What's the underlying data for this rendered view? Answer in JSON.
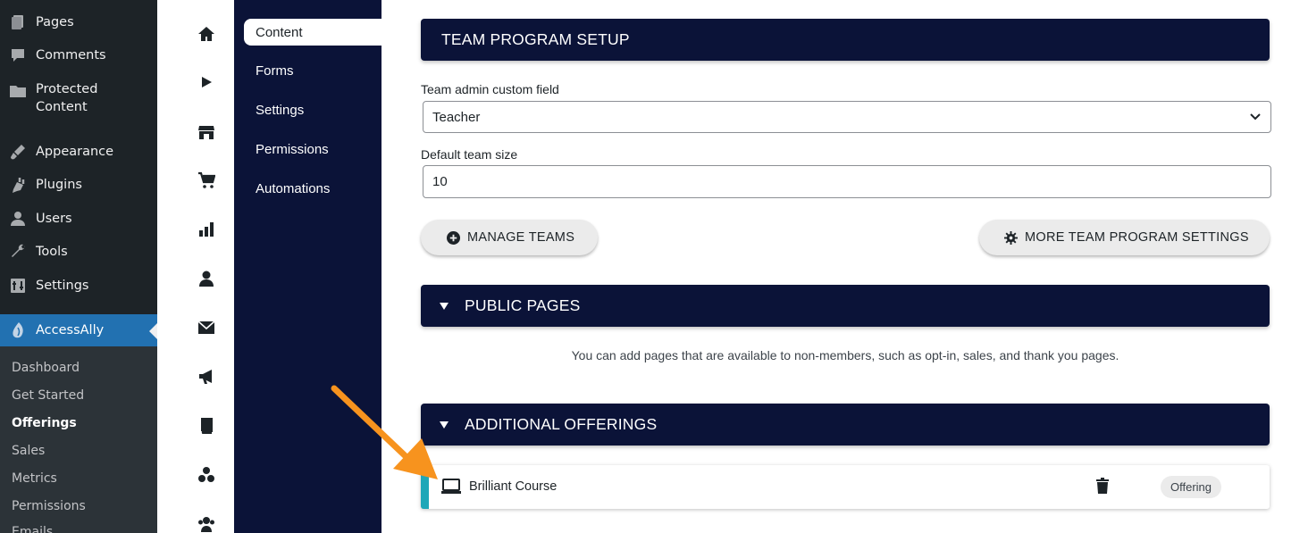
{
  "wp_menu": {
    "items": [
      {
        "label": "Pages",
        "icon": "pages-icon"
      },
      {
        "label": "Comments",
        "icon": "comments-icon"
      },
      {
        "label": "Protected Content",
        "icon": "folder-icon"
      },
      {
        "label": "Appearance",
        "icon": "appearance-icon"
      },
      {
        "label": "Plugins",
        "icon": "plugins-icon"
      },
      {
        "label": "Users",
        "icon": "users-icon"
      },
      {
        "label": "Tools",
        "icon": "tools-icon"
      },
      {
        "label": "Settings",
        "icon": "settings-icon"
      },
      {
        "label": "AccessAlly",
        "icon": "accessally-icon"
      }
    ],
    "submenu": [
      "Dashboard",
      "Get Started",
      "Offerings",
      "Sales",
      "Metrics",
      "Permissions",
      "Emails"
    ],
    "current_submenu": "Offerings"
  },
  "nav": {
    "items": [
      "Content",
      "Forms",
      "Settings",
      "Permissions",
      "Automations"
    ],
    "active": "Content"
  },
  "team_setup": {
    "title": "TEAM PROGRAM SETUP",
    "admin_field_label": "Team admin custom field",
    "admin_field_value": "Teacher",
    "team_size_label": "Default team size",
    "team_size_value": "10",
    "manage_teams_label": "MANAGE TEAMS",
    "more_settings_label": "MORE TEAM PROGRAM SETTINGS"
  },
  "public_pages": {
    "title": "PUBLIC PAGES",
    "hint": "You can add pages that are available to non-members, such as opt-in, sales, and thank you pages."
  },
  "additional_offerings": {
    "title": "ADDITIONAL OFFERINGS",
    "rows": [
      {
        "title": "Brilliant Course",
        "badge": "Offering"
      }
    ]
  },
  "colors": {
    "navy": "#0b1338",
    "wp_dark": "#1d2327",
    "wp_blue": "#2271b1",
    "teal": "#1fa7b8",
    "arrow": "#f7931e"
  }
}
